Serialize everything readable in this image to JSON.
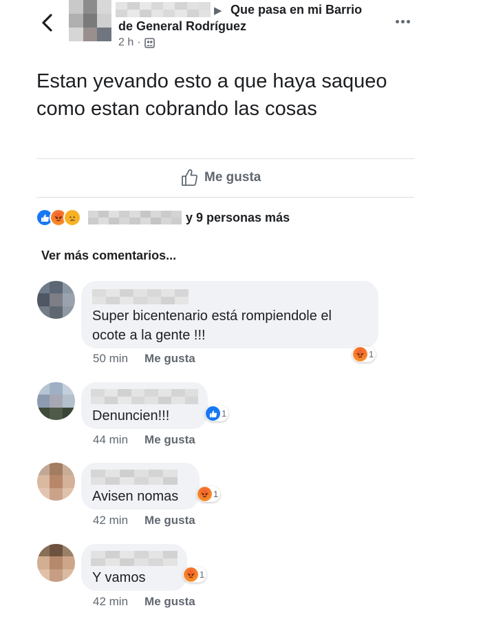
{
  "post": {
    "group_line1": "Que pasa en mi Barrio",
    "group_line2": "de General Rodríguez",
    "time": "2 h",
    "separator": "·",
    "text": "Estan yevando esto a que haya saqueo como estan cobrando las cosas",
    "like_label": "Me gusta",
    "reactions_tail": "y 9 personas más",
    "view_more": "Ver más comentarios..."
  },
  "icons": {
    "back": "chevron-left-icon",
    "more": "more-options-icon",
    "audience": "group-audience-icon",
    "like": "thumbs-up-icon",
    "reaction_like": "like-reaction-icon",
    "reaction_angry": "angry-reaction-icon",
    "reaction_sad": "sad-reaction-icon"
  },
  "colors": {
    "like_blue": "#1877f2",
    "angry_orange": "#e9710f",
    "sad_yellow": "#f7b125",
    "bubble_bg": "#f0f2f5",
    "secondary_text": "#606770"
  },
  "comments": [
    {
      "text": "Super bicentenario está rompiendole el",
      "text2": "ocote a la gente !!!",
      "time": "50 min",
      "like_label": "Me gusta",
      "reaction": "angry",
      "reaction_count": "1"
    },
    {
      "text": "Denuncien!!!",
      "time": "44 min",
      "like_label": "Me gusta",
      "reaction": "like",
      "reaction_count": "1"
    },
    {
      "text": "Avisen nomas",
      "time": "42 min",
      "like_label": "Me gusta",
      "reaction": "angry",
      "reaction_count": "1"
    },
    {
      "text": "Y vamos",
      "time": "42 min",
      "like_label": "Me gusta",
      "reaction": "angry",
      "reaction_count": "1"
    }
  ]
}
